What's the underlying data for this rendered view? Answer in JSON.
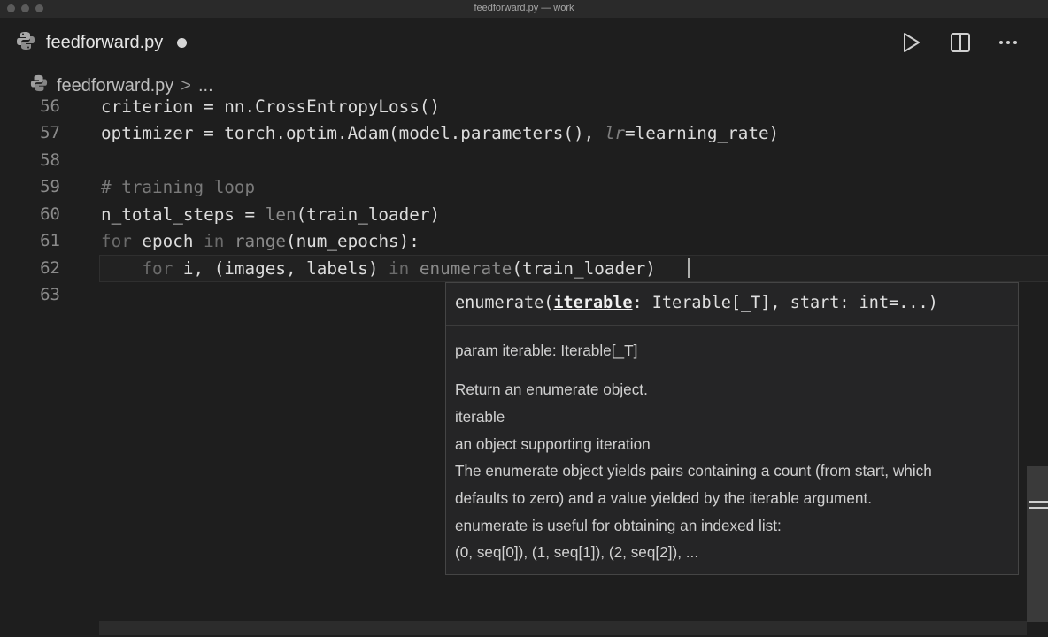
{
  "window": {
    "title": "feedforward.py — work"
  },
  "tab": {
    "filename": "feedforward.py",
    "icon": "python-icon",
    "unsaved_indicator": "dot"
  },
  "toolbar": {
    "run_icon": "play-icon",
    "split_icon": "split-editor-icon",
    "more_icon": "ellipsis-icon"
  },
  "breadcrumb": {
    "file": "feedforward.py",
    "separator": ">",
    "rest": "..."
  },
  "editor": {
    "lines": [
      {
        "number": "56",
        "text": "criterion = nn.CrossEntropyLoss()"
      },
      {
        "number": "57",
        "text": "optimizer = torch.optim.Adam(model.parameters(), lr=learning_rate)"
      },
      {
        "number": "58",
        "text": ""
      },
      {
        "number": "59",
        "text": "# training loop"
      },
      {
        "number": "60",
        "text": "n_total_steps = len(train_loader)"
      },
      {
        "number": "61",
        "text": "for epoch in range(num_epochs):"
      },
      {
        "number": "62",
        "text": "    for i, (images, labels) in enumerate(train_loader)"
      },
      {
        "number": "63",
        "text": ""
      }
    ]
  },
  "hover": {
    "signature_pre": "enumerate(",
    "signature_param": "iterable",
    "signature_post": ": Iterable[_T], start: int=...)",
    "param_line": "param iterable: Iterable[_T]",
    "doc_lines": [
      "Return an enumerate object.",
      "iterable",
      "an object supporting iteration",
      "The enumerate object yields pairs containing a count (from start, which",
      "defaults to zero) and a value yielded by the iterable argument.",
      "enumerate is useful for obtaining an indexed list:",
      "(0, seq[0]), (1, seq[1]), (2, seq[2]), ..."
    ]
  }
}
